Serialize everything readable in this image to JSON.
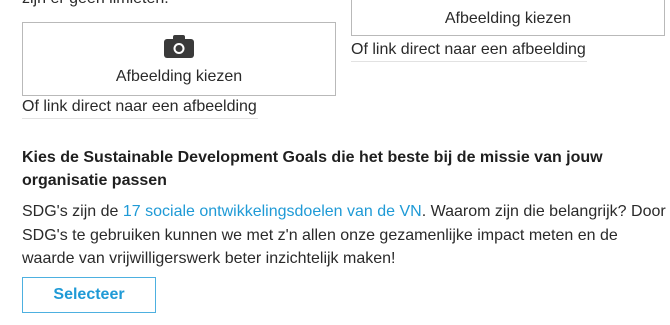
{
  "intro": {
    "text": "zijn er geen limieten."
  },
  "upload_left": {
    "icon": "camera-icon",
    "label": "Afbeelding kiezen",
    "link_placeholder": "Of link direct naar een afbeelding"
  },
  "upload_right": {
    "icon": "camera-icon",
    "label": "Afbeelding kiezen",
    "link_placeholder": "Of link direct naar een afbeelding"
  },
  "sdg": {
    "title": "Kies de Sustainable Development Goals die het beste bij de missie van jouw organisatie passen",
    "description_before": "SDG's zijn de ",
    "description_link": "17 sociale ontwikkelingsdoelen van de VN",
    "description_after": ". Waarom zijn die belangrijk? Door SDG's te gebruiken kunnen we met z'n allen onze gezamenlijke impact meten en de waarde van vrijwilligerswerk beter inzichtelijk maken!",
    "select_label": "Selecteer"
  },
  "colors": {
    "link": "#1f9ad6",
    "button_border": "#4db0e0",
    "box_border": "#b9b9b9"
  }
}
